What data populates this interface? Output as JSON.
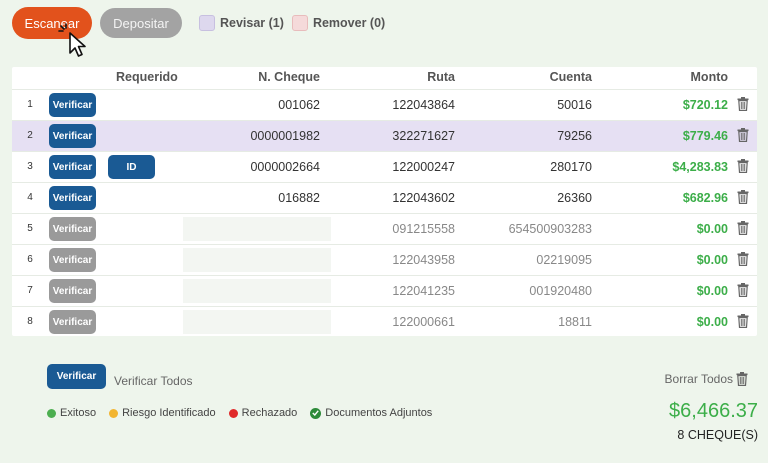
{
  "toolbar": {
    "scan_label": "Escanear",
    "deposit_label": "Depositar",
    "review_label": "Revisar (1)",
    "remove_label": "Remover (0)"
  },
  "table": {
    "headers": {
      "required": "Requerido",
      "check_number": "N. Cheque",
      "route": "Ruta",
      "account": "Cuenta",
      "amount": "Monto"
    },
    "rows": [
      {
        "index": "1",
        "verify": "Verificar",
        "id": "",
        "check_number": "001062",
        "route": "122043864",
        "account": "50016",
        "amount": "$720.12"
      },
      {
        "index": "2",
        "verify": "Verificar",
        "id": "",
        "check_number": "0000001982",
        "route": "322271627",
        "account": "79256",
        "amount": "$779.46"
      },
      {
        "index": "3",
        "verify": "Verificar",
        "id": "ID",
        "check_number": "0000002664",
        "route": "122000247",
        "account": "280170",
        "amount": "$4,283.83"
      },
      {
        "index": "4",
        "verify": "Verificar",
        "id": "",
        "check_number": "016882",
        "route": "122043602",
        "account": "26360",
        "amount": "$682.96"
      },
      {
        "index": "5",
        "verify": "Verificar",
        "id": "",
        "check_number": "",
        "route": "091215558",
        "account": "654500903283",
        "amount": "$0.00"
      },
      {
        "index": "6",
        "verify": "Verificar",
        "id": "",
        "check_number": "",
        "route": "122043958",
        "account": "02219095",
        "amount": "$0.00"
      },
      {
        "index": "7",
        "verify": "Verificar",
        "id": "",
        "check_number": "",
        "route": "122041235",
        "account": "001920480",
        "amount": "$0.00"
      },
      {
        "index": "8",
        "verify": "Verificar",
        "id": "",
        "check_number": "",
        "route": "122000661",
        "account": "18811",
        "amount": "$0.00"
      }
    ]
  },
  "footer": {
    "verify_label": "Verificar",
    "verify_all_label": "Verificar Todos",
    "clear_all_label": "Borrar Todos",
    "legend": {
      "success": "Exitoso",
      "risk": "Riesgo Identificado",
      "rejected": "Rechazado",
      "attached": "Documentos Adjuntos"
    },
    "total": "$6,466.37",
    "count": "8 CHEQUE(S)"
  },
  "colors": {
    "scan": "#e2521c",
    "verify_active": "#1a5a94",
    "verify_inactive": "#9a9a9a",
    "amount_green": "#3cae49",
    "selected_row": "#e6e0f3"
  }
}
